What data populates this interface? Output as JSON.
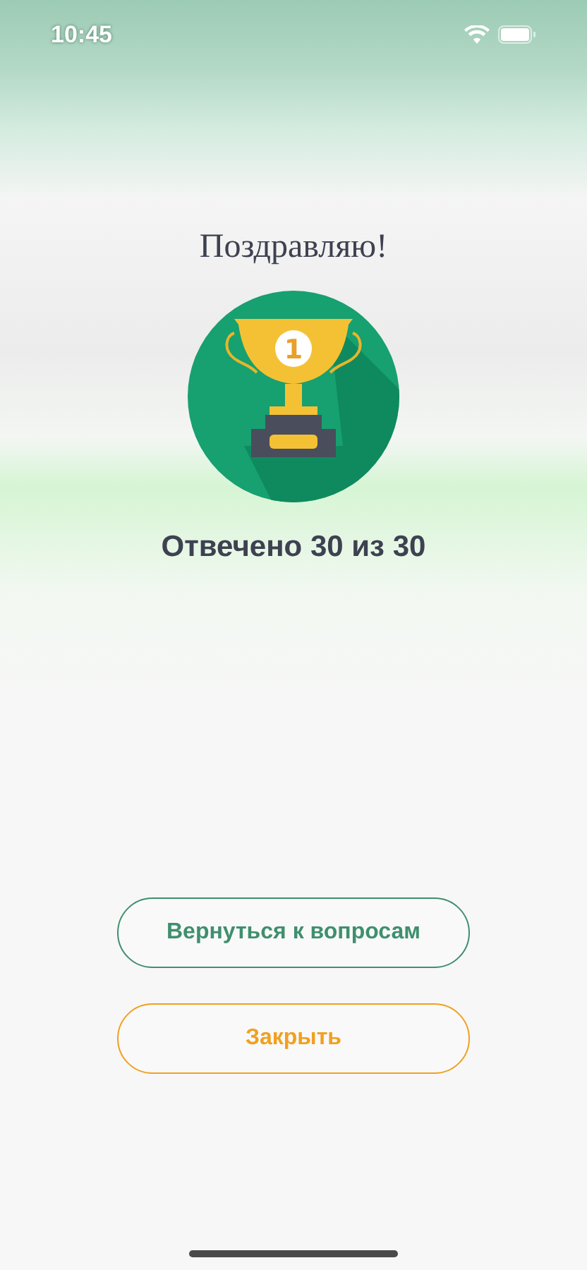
{
  "status_bar": {
    "time": "10:45"
  },
  "title": "Поздравляю!",
  "trophy": {
    "place": "1"
  },
  "score": "Отвечено **30** из **30**",
  "buttons": [
    {
      "label": "Вернуться к вопросам",
      "kind": "primary"
    },
    {
      "label": "Закрыть",
      "kind": "secondary"
    }
  ]
}
